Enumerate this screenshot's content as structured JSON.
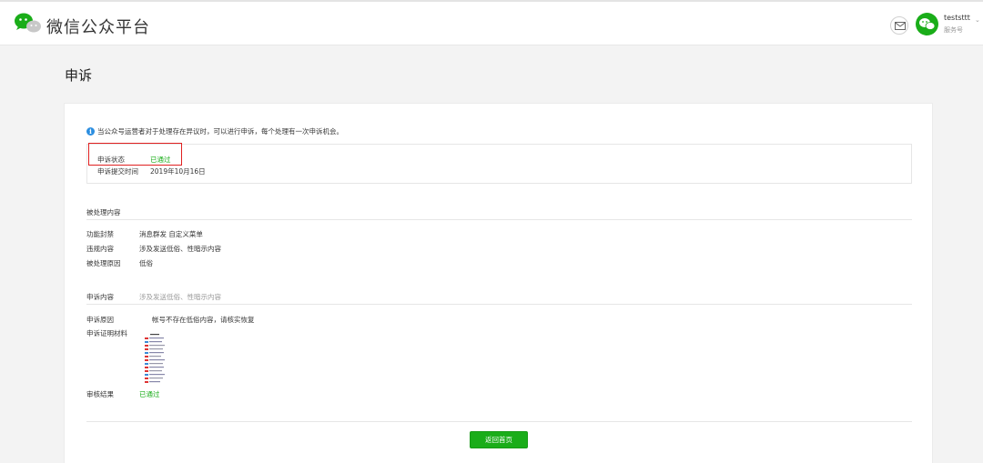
{
  "header": {
    "brand": "微信公众平台",
    "user_name": "teststtt",
    "user_type": "服务号",
    "caret": "⌄"
  },
  "page_title": "申诉",
  "notice": "当公众号运营者对于处理存在异议时，可以进行申诉，每个处理有一次申诉机会。",
  "status": {
    "state_label": "申诉状态",
    "state_value": "已通过",
    "time_label": "申诉提交时间",
    "time_value": "2019年10月16日"
  },
  "processed": {
    "section_title": "被处理内容",
    "function_label": "功能封禁",
    "function_value": "消息群发 自定义菜单",
    "violation_label": "违规内容",
    "violation_value": "涉及发送低俗、性暗示内容",
    "reason_label": "被处理原因",
    "reason_value": "低俗"
  },
  "appeal": {
    "content_label": "申诉内容",
    "content_value": "涉及发送低俗、性暗示内容",
    "reason_label": "申诉原因",
    "reason_value": "帐号不存在低俗内容，请核实恢复",
    "proof_label": "申诉证明材料",
    "result_label": "审核结果",
    "result_value": "已通过"
  },
  "back_button": "返回首页",
  "colors": {
    "accent_green": "#1aad19",
    "highlight_red": "#e02020",
    "info_blue": "#2b8ee0"
  },
  "icons": {
    "logo": "wechat-logo-icon",
    "mail": "mail-icon",
    "avatar": "wechat-avatar-icon",
    "info": "info-icon"
  }
}
